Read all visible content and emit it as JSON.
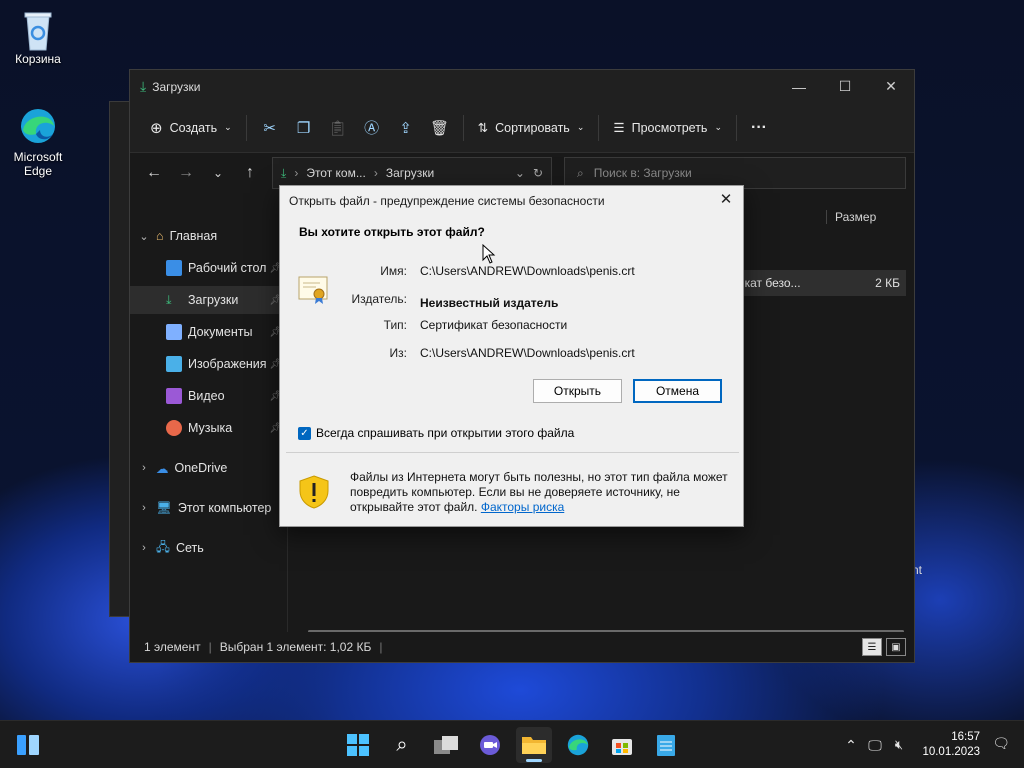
{
  "desktop": {
    "icons": [
      {
        "label": "Корзина",
        "icon": "recycle-bin-icon"
      },
      {
        "label": "Microsoft Edge",
        "icon": "edge-icon"
      }
    ],
    "stray_text": "nt"
  },
  "explorer": {
    "title": "Загрузки",
    "toolbar": {
      "create_label": "Создать",
      "sort_label": "Сортировать",
      "view_label": "Просмотреть"
    },
    "address": {
      "crumb1": "Этот ком...",
      "crumb2": "Загрузки"
    },
    "search": {
      "placeholder": "Поиск в: Загрузки"
    },
    "sidebar": {
      "home": "Главная",
      "items": [
        {
          "label": "Рабочий стол",
          "color": "#3a8ee6"
        },
        {
          "label": "Загрузки",
          "color": "#3dbd7d"
        },
        {
          "label": "Документы",
          "color": "#7fb0ff"
        },
        {
          "label": "Изображения",
          "color": "#4ab0e8"
        },
        {
          "label": "Видео",
          "color": "#9b59d6"
        },
        {
          "label": "Музыка",
          "color": "#e8684a"
        }
      ],
      "onedrive": "OneDrive",
      "this_pc": "Этот компьютер",
      "network": "Сеть"
    },
    "columns": {
      "size": "Размер"
    },
    "file": {
      "type_partial": "фикат безо...",
      "size": "2 КБ"
    },
    "status": {
      "count": "1 элемент",
      "selected": "Выбран 1 элемент: 1,02 КБ"
    }
  },
  "dialog": {
    "title": "Открыть файл - предупреждение системы безопасности",
    "heading": "Вы хотите открыть этот файл?",
    "fields": {
      "name_label": "Имя:",
      "name_value": "C:\\Users\\ANDREW\\Downloads\\penis.crt",
      "publisher_label": "Издатель:",
      "publisher_value": "Неизвестный издатель",
      "type_label": "Тип:",
      "type_value": "Сертификат безопасности",
      "from_label": "Из:",
      "from_value": "C:\\Users\\ANDREW\\Downloads\\penis.crt"
    },
    "open_button": "Открыть",
    "cancel_button": "Отмена",
    "checkbox_label": "Всегда спрашивать при открытии этого файла",
    "checkbox_checked": true,
    "warning_text": "Файлы из Интернета могут быть полезны, но этот тип файла может повредить компьютер. Если вы не доверяете источнику, не открывайте этот файл.",
    "risk_link": "Факторы риска"
  },
  "taskbar": {
    "time": "16:57",
    "date": "10.01.2023"
  }
}
